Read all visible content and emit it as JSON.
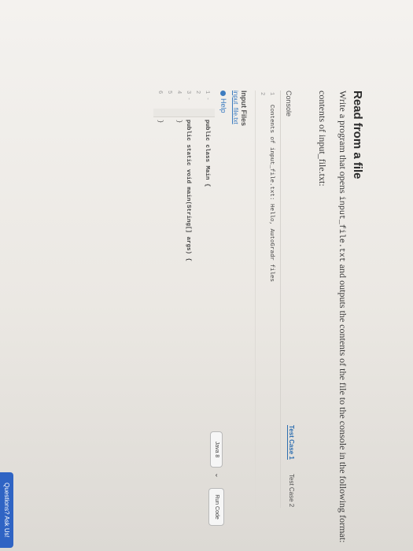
{
  "problem": {
    "title": "Read from a file",
    "description_prefix": "Write a program that opens",
    "file_name": "input_file.txt",
    "description_suffix": "and outputs the contents of the file to the console in the following format:",
    "format_line": "contents of input_file.txt:"
  },
  "tabs": [
    {
      "label": "Test Case 1",
      "active": true
    },
    {
      "label": "Test Case 2",
      "active": false
    }
  ],
  "console": {
    "label": "Console",
    "lines": [
      {
        "num": "1",
        "text": "Contents of input_file.txt: Hello, AutoGradr files"
      },
      {
        "num": "2",
        "text": ""
      }
    ]
  },
  "input_files": {
    "label": "Input Files",
    "file_link": "input_file.txt"
  },
  "help": {
    "label": "Help",
    "icon": "help-circle-icon"
  },
  "editor": {
    "language": "Java 8",
    "run_label": "Run Code",
    "lines": [
      {
        "num": "1 -",
        "text": "public class Main {"
      },
      {
        "num": "2",
        "text": ""
      },
      {
        "num": "3 -",
        "text": "    public static void main(String[] args) {"
      },
      {
        "num": "4",
        "text": "    }"
      },
      {
        "num": "5",
        "text": ""
      },
      {
        "num": "6",
        "text": "}"
      }
    ]
  },
  "questions": {
    "label": "Questions? Ask Us!",
    "color": "#2f64c4"
  }
}
